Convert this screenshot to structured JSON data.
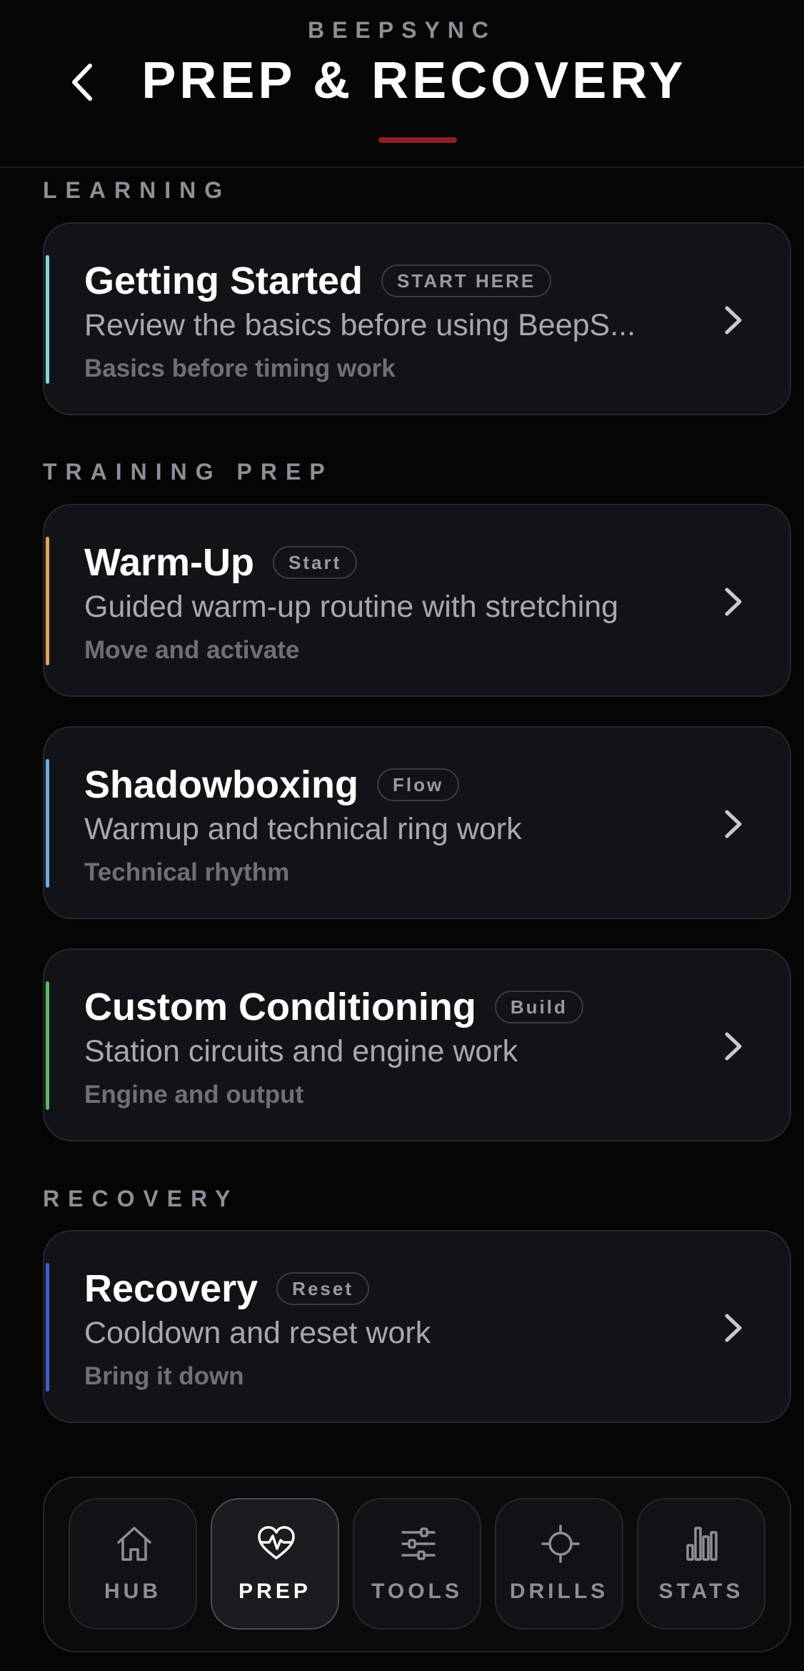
{
  "header": {
    "brand": "BEEPSYNC",
    "title": "PREP & RECOVERY"
  },
  "sections": {
    "learning": "LEARNING",
    "training_prep": "TRAINING PREP",
    "recovery": "RECOVERY"
  },
  "cards": [
    {
      "title": "Getting Started",
      "badge": "START HERE",
      "desc": "Review the basics before using BeepS...",
      "sub": "Basics before timing work",
      "accent": "#7fd6d6"
    },
    {
      "title": "Warm-Up",
      "badge": "Start",
      "desc": "Guided warm-up routine with stretching",
      "sub": "Move and activate",
      "accent": "#e0a455"
    },
    {
      "title": "Shadowboxing",
      "badge": "Flow",
      "desc": "Warmup and technical ring work",
      "sub": "Technical rhythm",
      "accent": "#6aaee0"
    },
    {
      "title": "Custom Conditioning",
      "badge": "Build",
      "desc": "Station circuits and engine work",
      "sub": "Engine and output",
      "accent": "#5ab865"
    },
    {
      "title": "Recovery",
      "badge": "Reset",
      "desc": "Cooldown and reset work",
      "sub": "Bring it down",
      "accent": "#3f5fd0"
    }
  ],
  "nav": {
    "tabs": [
      {
        "label": "HUB",
        "icon": "home-icon"
      },
      {
        "label": "PREP",
        "icon": "heart-pulse-icon",
        "active": true
      },
      {
        "label": "TOOLS",
        "icon": "sliders-icon"
      },
      {
        "label": "DRILLS",
        "icon": "crosshair-icon"
      },
      {
        "label": "STATS",
        "icon": "bar-chart-icon"
      }
    ]
  },
  "colors": {
    "background": "#050505",
    "card": "#121316",
    "header_accent": "#8f1f24"
  }
}
